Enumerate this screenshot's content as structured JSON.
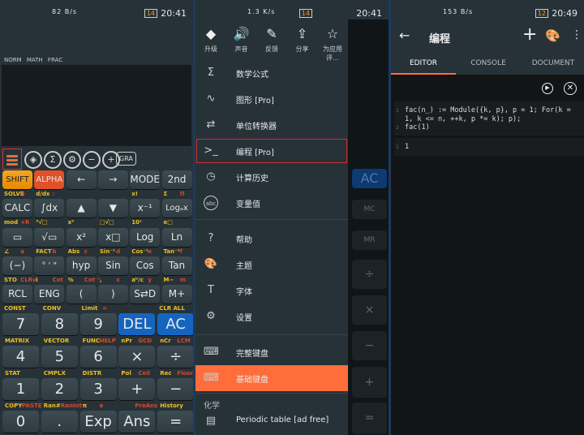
{
  "status": [
    {
      "time": "20:41",
      "net": "82 B/s",
      "battery": "14"
    },
    {
      "time": "20:41",
      "net": "1.3 K/s",
      "battery": "14"
    },
    {
      "time": "20:49",
      "net": "153 B/s",
      "battery": "12"
    }
  ],
  "calc": {
    "modes": "NORM MATH FRAC",
    "toolbar": [
      {
        "icon": "menu-icon"
      },
      {
        "icon": "theme-icon",
        "g": "◈"
      },
      {
        "icon": "sigma-icon",
        "g": "Σ"
      },
      {
        "icon": "gear-icon",
        "g": "⚙"
      },
      {
        "icon": "minus-icon",
        "g": "−"
      },
      {
        "icon": "plus-icon",
        "g": "+"
      }
    ],
    "gra": "GRA",
    "top_rows": [
      [
        "SHIFT",
        "ALPHA",
        "←",
        "→",
        "MODE",
        "2nd"
      ],
      [
        "CALC",
        "∫dx",
        "▲",
        "▼",
        "x⁻¹",
        "Logₐx"
      ],
      [
        "▭",
        "√▭",
        "x²",
        "x□",
        "Log",
        "Ln"
      ],
      [
        "(−)",
        "° ' \"",
        "hyp",
        "Sin",
        "Cos",
        "Tan"
      ],
      [
        "RCL",
        "ENG",
        "(",
        ")",
        "S⇄D",
        "M+"
      ]
    ],
    "top_subs": [
      [
        [
          "SOLVE",
          "="
        ],
        [
          "d/dx",
          ":"
        ],
        [
          "",
          ""
        ],
        [
          "",
          ""
        ],
        [
          "x!",
          ""
        ],
        [
          "Σ",
          "Π"
        ]
      ],
      [
        [
          "mod",
          "+R"
        ],
        [
          "³√□",
          ""
        ],
        [
          "x³",
          ""
        ],
        [
          "□√□",
          ""
        ],
        [
          "10ˣ",
          ""
        ],
        [
          "e□",
          ""
        ]
      ],
      [
        [
          "∠",
          "a"
        ],
        [
          "FACT",
          "b"
        ],
        [
          "Abs",
          "c"
        ],
        [
          "Sin⁻¹",
          "d"
        ],
        [
          "Cos⁻¹",
          "e"
        ],
        [
          "Tan⁻¹",
          "f"
        ]
      ],
      [
        [
          "STO",
          "CLRv"
        ],
        [
          "i",
          "Cot"
        ],
        [
          "%",
          "Cot⁻¹"
        ],
        [
          ",",
          "x"
        ],
        [
          "aᵇ/c",
          "y"
        ],
        [
          "M−",
          "m"
        ]
      ],
      [
        [
          "CONST",
          ""
        ],
        [
          "CONV",
          ""
        ],
        [
          "Limit",
          "="
        ],
        [
          "",
          ""
        ],
        [
          "CLR ALL",
          ""
        ]
      ]
    ],
    "bottom_rows": [
      [
        "7",
        "8",
        "9",
        "DEL",
        "AC"
      ],
      [
        "4",
        "5",
        "6",
        "×",
        "÷"
      ],
      [
        "1",
        "2",
        "3",
        "+",
        "−"
      ],
      [
        "0",
        ".",
        "Exp",
        "Ans",
        "="
      ]
    ],
    "bottom_subs": [
      [
        [
          "MATRIX",
          ""
        ],
        [
          "VECTOR",
          ""
        ],
        [
          "FUNC",
          "HELP"
        ],
        [
          "nPr",
          "GCD"
        ],
        [
          "nCr",
          "LCM"
        ]
      ],
      [
        [
          "STAT",
          ""
        ],
        [
          "CMPLX",
          ""
        ],
        [
          "DISTR",
          ""
        ],
        [
          "Pol",
          "Ceil"
        ],
        [
          "Rec",
          "Floor"
        ]
      ],
      [
        [
          "COPY",
          "PASTE"
        ],
        [
          "Ran#",
          "RanInt"
        ],
        [
          "π",
          "e"
        ],
        [
          "",
          "PreAns"
        ],
        [
          "History",
          ""
        ]
      ]
    ],
    "colors": {
      "shift": "#f5a623",
      "alpha": "#e0502a",
      "blue": "#1565c0",
      "yellow": "#f0c020",
      "red": "#e0442a"
    }
  },
  "drawer": {
    "top": [
      {
        "label": "升级",
        "icon": "diamond-icon",
        "g": "◆"
      },
      {
        "label": "声音",
        "icon": "speaker-icon",
        "g": "🔊"
      },
      {
        "label": "反馈",
        "icon": "feedback-icon",
        "g": "✎"
      },
      {
        "label": "分享",
        "icon": "share-icon",
        "g": "⇪"
      },
      {
        "label": "为应用评…",
        "icon": "star-icon",
        "g": "☆"
      }
    ],
    "items": [
      {
        "label": "数学公式",
        "icon": "sigma-icon",
        "g": "Σ"
      },
      {
        "label": "图形 [Pro]",
        "icon": "graph-icon",
        "g": "∿"
      },
      {
        "label": "单位转换器",
        "icon": "convert-icon",
        "g": "⇄"
      },
      {
        "label": "编程 [Pro]",
        "icon": "terminal-icon",
        "g": ">_"
      },
      {
        "label": "计算历史",
        "icon": "history-icon",
        "g": "◷"
      },
      {
        "label": "变量值",
        "icon": "abc-icon",
        "g": "abc"
      },
      {
        "label": "帮助",
        "icon": "help-icon",
        "g": "?"
      },
      {
        "label": "主题",
        "icon": "palette-icon",
        "g": "🎨"
      },
      {
        "label": "字体",
        "icon": "font-icon",
        "g": "T"
      },
      {
        "label": "设置",
        "icon": "gear-icon",
        "g": "⚙"
      },
      {
        "label": "完整键盘",
        "icon": "keyboard-icon",
        "g": "⌨"
      },
      {
        "label": "基础键盘",
        "icon": "keyboard-icon",
        "g": "⌨"
      }
    ],
    "section": "化学",
    "periodic": "Periodic table [ad free]",
    "accent": "#ff6d3a",
    "behind_keys": [
      "AC",
      "MC",
      "MR",
      "÷",
      "×",
      "−",
      "+",
      "="
    ]
  },
  "editor": {
    "title": "编程",
    "tabs": [
      "EDITOR",
      "CONSOLE",
      "DOCUMENT"
    ],
    "active_tab": "EDITOR",
    "code_lines": [
      "fac(n_) := Module({k, p}, p = 1; For(k =",
      "1, k <= n, ++k, p *= k); p);",
      "fac(1)"
    ],
    "line_numbers": [
      "1",
      "",
      "2"
    ],
    "output_line": "1",
    "output": "1"
  }
}
